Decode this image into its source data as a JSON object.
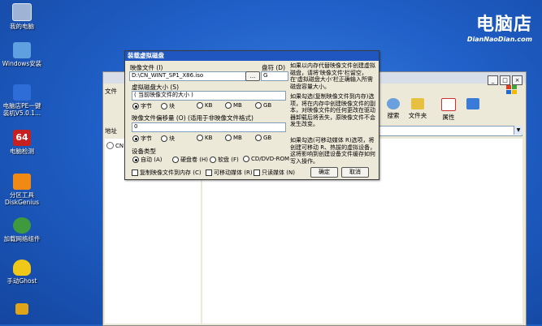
{
  "desktop": {
    "icons": [
      {
        "label": "我的电脑",
        "color": "#9fb3d6"
      },
      {
        "label": "Windows安装",
        "color": "#5fa0e0"
      },
      {
        "label": "电脑店PE一键\n装机V5.0.1...",
        "color": "#2e6dd8"
      },
      {
        "label": "电脑检测",
        "color": "#c62020"
      },
      {
        "label": "分区工具\nDiskGenius",
        "color": "#f08a14"
      },
      {
        "label": "加载网络组件",
        "color": "#3f9a3f"
      },
      {
        "label": "手动Ghost",
        "color": "#f0c818"
      }
    ],
    "logo_main": "电脑店",
    "logo_sub": "DianNaoDian.com"
  },
  "explorer": {
    "toolbar": [
      {
        "label": "搜索",
        "color": "#6aa0de"
      },
      {
        "label": "文件夹",
        "color": "#e8c040"
      },
      {
        "label": "属性",
        "color": "#cc3030"
      },
      {
        "label": "",
        "color": "#3a7ad8"
      }
    ],
    "menu_fragment": "文件",
    "address_label": "地址",
    "tree_item": "CN"
  },
  "dialog": {
    "title": "装载虚拟磁盘",
    "image_file_label": "映像文件 (I)",
    "image_file_value": "D:\\CN_WINT_SP1_X86.iso",
    "browse_label": "...",
    "drive_label": "盘符 (D)",
    "drive_value": "G",
    "size_group_label": "虚拟磁盘大小 (S)",
    "size_value": "( 当前映像文件的大小 )",
    "size_units": [
      "字节",
      "块",
      "KB",
      "MB",
      "GB"
    ],
    "offset_label": "映像文件偏移量 (O) (适用于非映像文件格式)",
    "offset_value": "0",
    "offset_units": [
      "字节",
      "块",
      "KB",
      "MB",
      "GB"
    ],
    "device_group_label": "设备类型",
    "device_types": [
      "自动 (A)",
      "硬盘卷 (H)",
      "软盘 (F)",
      "CD/DVD-ROM"
    ],
    "check_copy": "复制映像文件到内存 (C)",
    "check_removable": "可移动媒体 (R)",
    "check_readonly": "只读媒体 (N)",
    "ok_label": "确定",
    "cancel_label": "取消",
    "help1": "如果以内存代替映像文件创建虚拟磁盘，请将'映像文件'栏留空，在'虚拟磁盘大小'栏正确输入所需磁盘容量大小。",
    "help2": "如果勾选(复制映像文件到内存)选项，将在内存中创建映像文件的副本，对映像文件的任何更改在驱动器卸载后将丢失，原映像文件不会发生改变。",
    "help3": "如果勾选(可移动媒体 R)选项，将创建可移动 R、热拔的虚拟设备，这将影响到创建设备文件缓存如何写入操作。"
  }
}
